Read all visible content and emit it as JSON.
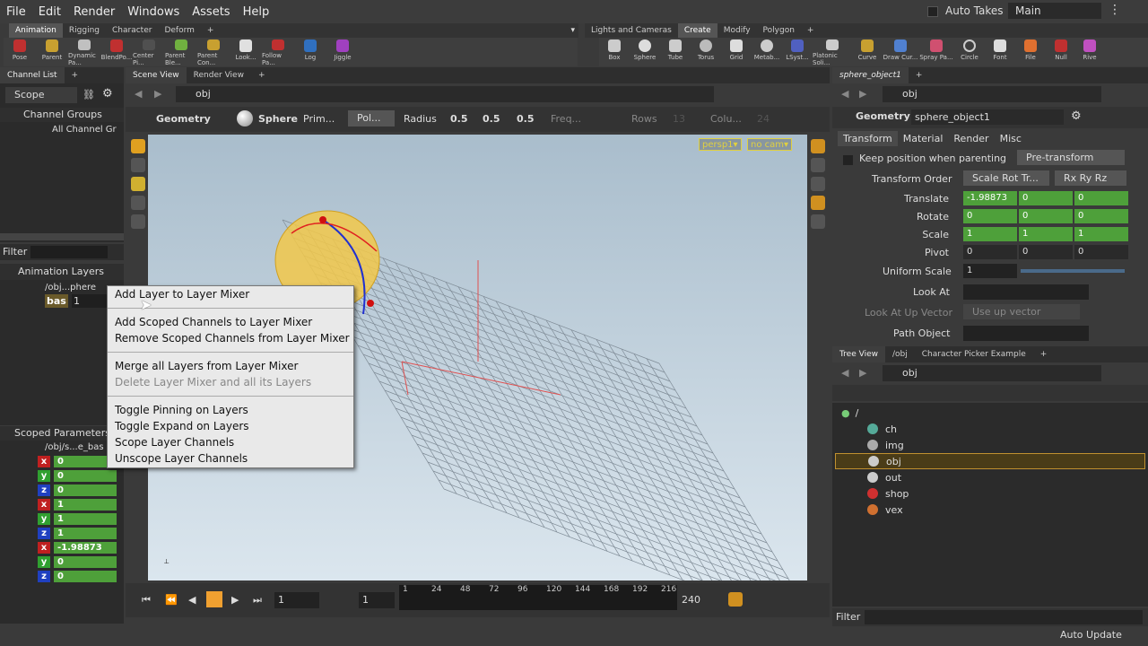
{
  "menubar": {
    "items": [
      "File",
      "Edit",
      "Render",
      "Windows",
      "Assets",
      "Help"
    ],
    "auto_takes": "Auto Takes",
    "desktop": "Main"
  },
  "shelf_left": {
    "tabs": [
      "Animation",
      "Rigging",
      "Character",
      "Deform"
    ],
    "tools": [
      "Pose",
      "Parent",
      "Dynamic Pa...",
      "BlendPo...",
      "Center Pi...",
      "Parent Ble...",
      "Parent Con...",
      "Look...",
      "Follow Pa...",
      "Log",
      "Jiggle"
    ]
  },
  "shelf_right": {
    "tabs": [
      "Lights and Cameras",
      "Create",
      "Modify",
      "Polygon"
    ],
    "tools": [
      "Box",
      "Sphere",
      "Tube",
      "Torus",
      "Grid",
      "Metab...",
      "LSyst...",
      "Platonic Soli...",
      "Curve",
      "Draw Cur...",
      "Spray Pa...",
      "Circle",
      "Font",
      "File",
      "Null",
      "Rive"
    ]
  },
  "left": {
    "tab": "Channel List",
    "scope": "Scope",
    "channel_groups": "Channel Groups",
    "all_channel": "All Channel Gr",
    "filter": "Filter",
    "animation_layers": "Animation Layers",
    "layer_obj": "/obj...phere",
    "layer_base": "bas",
    "layer_base_val": "1",
    "scoped_params": "Scoped Parameters",
    "scoped_path": "/obj/s...e_bas",
    "channels": [
      {
        "axis": "x",
        "val": "0"
      },
      {
        "axis": "y",
        "val": "0"
      },
      {
        "axis": "z",
        "val": "0"
      },
      {
        "axis": "x",
        "val": "1"
      },
      {
        "axis": "y",
        "val": "1"
      },
      {
        "axis": "z",
        "val": "1"
      },
      {
        "axis": "x",
        "val": "-1.98873"
      },
      {
        "axis": "y",
        "val": "0"
      },
      {
        "axis": "z",
        "val": "0"
      }
    ]
  },
  "center": {
    "tabs": [
      "Scene View",
      "Render View"
    ],
    "path": "obj",
    "geo_label": "Geometry",
    "sphere_label": "Sphere",
    "prim_label": "Prim...",
    "pol_label": "Pol...",
    "radius_label": "Radius",
    "radius": [
      "0.5",
      "0.5",
      "0.5"
    ],
    "freq": "Freq...",
    "rows": "Rows",
    "rows_val": "13",
    "cols": "Colu...",
    "cols_val": "24",
    "persp": "persp1▾",
    "nocam": "no cam▾"
  },
  "ctxmenu": {
    "items": [
      "Add Layer to Layer Mixer",
      "Add Scoped Channels to Layer Mixer",
      "Remove Scoped Channels from Layer Mixer",
      "Merge all Layers from Layer Mixer",
      "Delete Layer Mixer and all its Layers",
      "Toggle Pinning on Layers",
      "Toggle Expand on Layers",
      "Scope Layer Channels",
      "Unscope Layer Channels"
    ]
  },
  "timeline": {
    "frame": "1",
    "start": "1",
    "end": "240",
    "ticks": [
      "1",
      "24",
      "48",
      "72",
      "96",
      "120",
      "144",
      "168",
      "192",
      "216"
    ]
  },
  "params": {
    "tab": "sphere_object1",
    "path": "obj",
    "geo_label": "Geometry",
    "node_name": "sphere_object1",
    "tabs": [
      "Transform",
      "Material",
      "Render",
      "Misc"
    ],
    "keep_pos": "Keep position when parenting",
    "pretransform": "Pre-transform",
    "transform_order_label": "Transform Order",
    "transform_order": "Scale Rot Tr...",
    "rot_order": "Rx Ry Rz",
    "rows": [
      {
        "label": "Translate",
        "vals": [
          "-1.98873",
          "0",
          "0"
        ]
      },
      {
        "label": "Rotate",
        "vals": [
          "0",
          "0",
          "0"
        ]
      },
      {
        "label": "Scale",
        "vals": [
          "1",
          "1",
          "1"
        ]
      },
      {
        "label": "Pivot",
        "vals": [
          "0",
          "0",
          "0"
        ]
      }
    ],
    "uniform_scale_label": "Uniform Scale",
    "uniform_scale": "1",
    "look_at": "Look At",
    "look_up_label": "Look At Up Vector",
    "look_up": "Use up vector",
    "path_object": "Path Object"
  },
  "tree": {
    "tabs": [
      "Tree View",
      "/obj",
      "Character Picker Example"
    ],
    "path": "obj",
    "root": "/",
    "items": [
      "ch",
      "img",
      "obj",
      "out",
      "shop",
      "vex"
    ],
    "filter": "Filter",
    "auto_update": "Auto Update"
  }
}
